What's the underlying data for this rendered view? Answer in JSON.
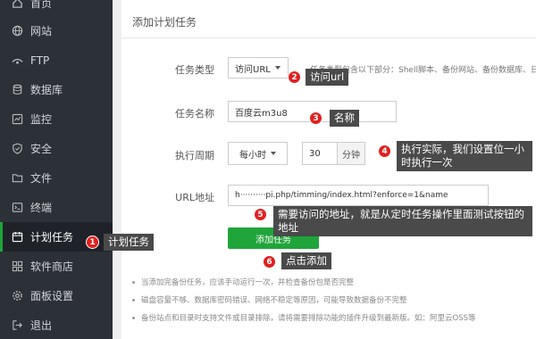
{
  "sidebar": {
    "items": [
      {
        "label": "首页",
        "icon": "home-icon"
      },
      {
        "label": "网站",
        "icon": "globe-icon"
      },
      {
        "label": "FTP",
        "icon": "ftp-icon"
      },
      {
        "label": "数据库",
        "icon": "database-icon"
      },
      {
        "label": "监控",
        "icon": "monitor-icon"
      },
      {
        "label": "安全",
        "icon": "shield-icon"
      },
      {
        "label": "文件",
        "icon": "folder-icon"
      },
      {
        "label": "终端",
        "icon": "terminal-icon"
      },
      {
        "label": "计划任务",
        "icon": "calendar-icon",
        "active": true
      },
      {
        "label": "软件商店",
        "icon": "grid-icon"
      },
      {
        "label": "面板设置",
        "icon": "gear-icon"
      },
      {
        "label": "退出",
        "icon": "logout-icon"
      }
    ]
  },
  "form": {
    "title": "添加计划任务",
    "task_type_label": "任务类型",
    "task_type_value": "访问URL",
    "task_type_hint": "任务类型包含以下部分：Shell脚本、备份网站、备份数据库、日",
    "task_name_label": "任务名称",
    "task_name_value": "百度云m3u8",
    "period_label": "执行周期",
    "period_value": "每小时",
    "minute_value": "30",
    "minute_suffix": "分钟",
    "url_label": "URL地址",
    "url_value": "h··········pi.php/timming/index.html?enforce=1&name",
    "submit_label": "添加任务"
  },
  "notes": [
    "当添加完备份任务，应该手动运行一次，并检查备份包是否完整",
    "磁盘容量不够、数据库密码错误、网络不稳定等原因，可能导致数据备份不完整",
    "备份站点和目录时支持文件或目录排除，请将需要排除功能的插件升级到最新版。如：阿里云OSS等"
  ],
  "annotations": [
    {
      "num": "1",
      "text": "计划任务"
    },
    {
      "num": "2",
      "text": "访问url"
    },
    {
      "num": "3",
      "text": "名称"
    },
    {
      "num": "4",
      "text": "执行实际，我们设置位一小时执行一次"
    },
    {
      "num": "5",
      "text": "需要访问的地址，就是从定时任务操作里面测试按钮的地址"
    },
    {
      "num": "6",
      "text": "点击添加"
    }
  ],
  "colors": {
    "sidebar_bg": "#2c3138",
    "accent_green": "#20a53a",
    "badge_red": "#e02020",
    "callout_bg": "#4a4a4a"
  }
}
